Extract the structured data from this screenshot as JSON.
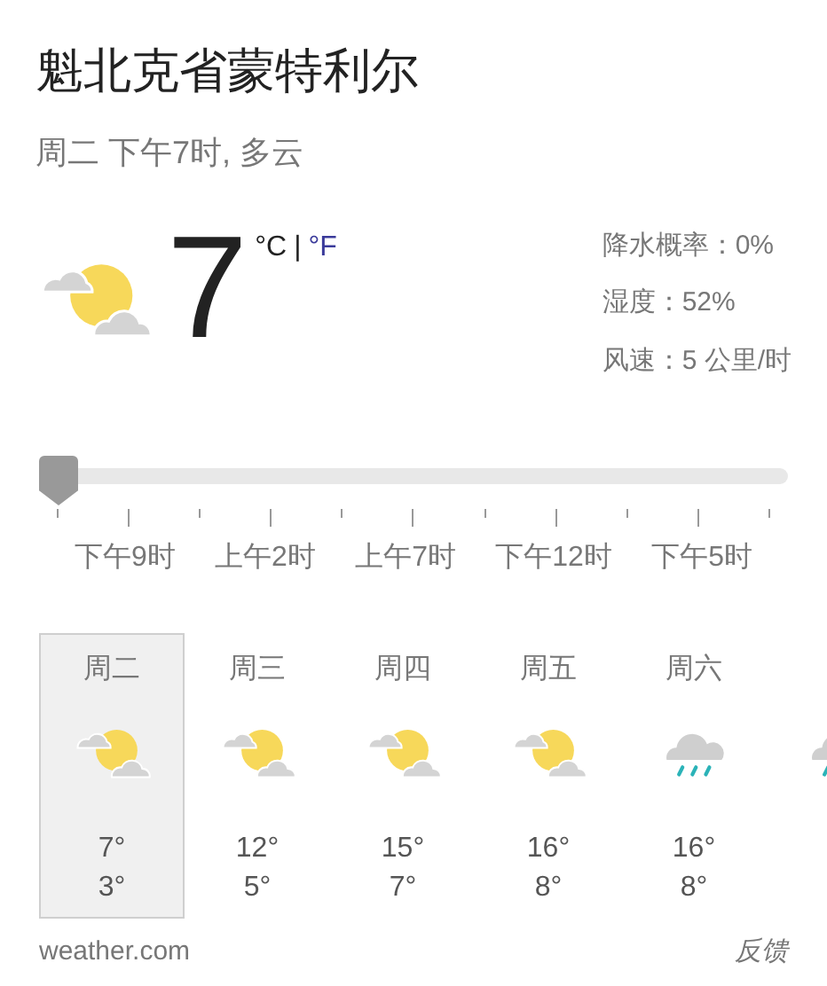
{
  "location": "魁北克省蒙特利尔",
  "subtitle": "周二 下午7时, 多云",
  "current": {
    "kind": "partly_cloudy",
    "temperature": "7",
    "unit_c": "°C",
    "separator": "|",
    "unit_f": "°F"
  },
  "details": [
    "降水概率：0%",
    "湿度：52%",
    "风速：5 公里/时"
  ],
  "slider": {
    "level": 0,
    "labels": [
      "下午9时",
      "上午2时",
      "上午7时",
      "下午12时",
      "下午5时"
    ]
  },
  "forecast": [
    {
      "day": "周二",
      "kind": "partly_cloudy",
      "high": "7°",
      "low": "3°",
      "selected": true
    },
    {
      "day": "周三",
      "kind": "partly_cloudy",
      "high": "12°",
      "low": "5°",
      "selected": false
    },
    {
      "day": "周四",
      "kind": "partly_cloudy",
      "high": "15°",
      "low": "7°",
      "selected": false
    },
    {
      "day": "周五",
      "kind": "partly_cloudy",
      "high": "16°",
      "low": "8°",
      "selected": false
    },
    {
      "day": "周六",
      "kind": "rain",
      "high": "16°",
      "low": "8°",
      "selected": false
    },
    {
      "kind": "rain",
      "selected": false
    }
  ],
  "source": "weather.com",
  "feedback": "反馈"
}
